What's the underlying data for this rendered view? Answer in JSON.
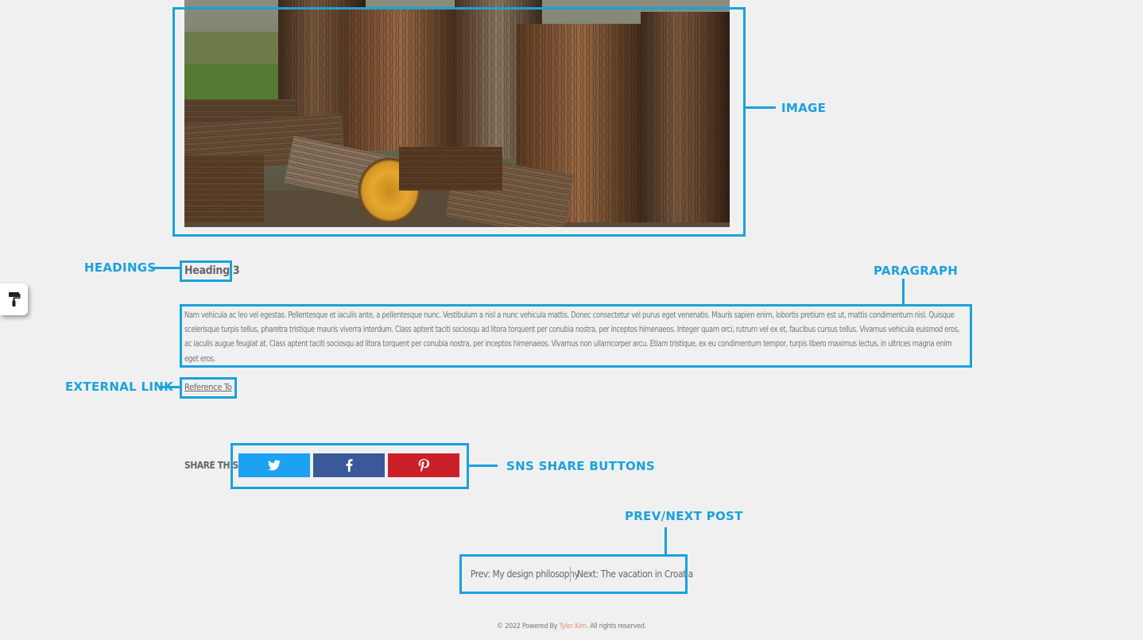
{
  "annotations": {
    "image": "IMAGE",
    "headings": "HEADINGS",
    "paragraph": "PARAGRAPH",
    "external_link": "EXTERNAL LINK",
    "sns_share_buttons": "SNS SHARE BUTTONS",
    "prev_next_post": "PREV/NEXT POST"
  },
  "post": {
    "heading": "Heading 3",
    "paragraph": "Nam vehicula ac leo vel egestas. Pellentesque et iaculis ante, a pellentesque nunc. Vestibulum a nisl a nunc vehicula mattis. Donec consectetur vel purus eget venenatis. Mauris sapien enim, lobortis pretium est ut, mattis condimentum nisl. Quisque scelerisque turpis tellus, pharetra tristique mauris viverra interdum. Class aptent taciti sociosqu ad litora torquent per conubia nostra, per inceptos himenaeos. Integer quam orci, rutrum vel ex et, faucibus cursus tellus. Vivamus vehicula euismod eros, ac iaculis augue feugiat at. Class aptent taciti sociosqu ad litora torquent per conubia nostra, per inceptos himenaeos. Vivamus non ullamcorper arcu. Etiam tristique, ex eu condimentum tempor, turpis libero maximus lectus, in ultrices magna enim eget eros.",
    "reference_link": "Reference To"
  },
  "share": {
    "label": "SHARE THIS",
    "buttons": [
      {
        "network": "twitter",
        "icon": "twitter-icon",
        "color": "#1da1f2"
      },
      {
        "network": "facebook",
        "icon": "facebook-icon",
        "color": "#3b5998"
      },
      {
        "network": "pinterest",
        "icon": "pinterest-icon",
        "color": "#cb2027"
      }
    ]
  },
  "navigation": {
    "prev": "Prev: My design philosophy",
    "next": "Next: The vacation in Croatia"
  },
  "footer": {
    "prefix": "© 2022 Powered By",
    "author": "Tyler Kim",
    "suffix": ". All rights reserved."
  },
  "colors": {
    "accent": "#1ba1db",
    "background": "#f0f0f1",
    "author": "#e8927c"
  }
}
